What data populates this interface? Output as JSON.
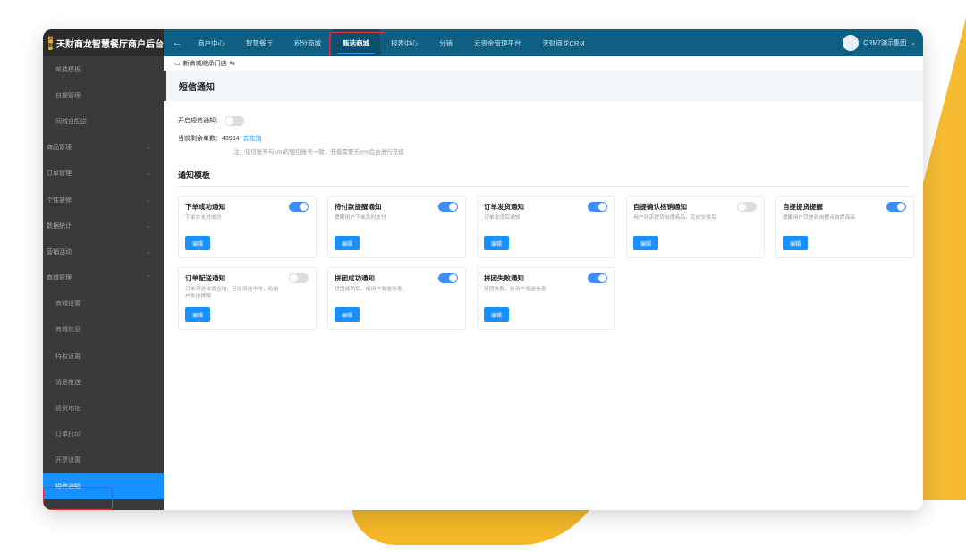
{
  "topbar": {
    "brand_logo_text": "天财商龙",
    "brand_title": "天财商龙智慧餐厅商户后台",
    "nav": [
      "商户中心",
      "智慧餐厅",
      "积分商城",
      "甄选商城",
      "报表中心",
      "分销",
      "云资金管理平台",
      "天财商龙CRM"
    ],
    "active_nav_index": 3,
    "org_name": "CRM7演示集团"
  },
  "sidebar": {
    "items": [
      {
        "label": "邮费模板",
        "type": "sub"
      },
      {
        "label": "自提管理",
        "type": "sub"
      },
      {
        "label": "同城自配送",
        "type": "sub"
      },
      {
        "label": "商品管理",
        "type": "group",
        "expanded": false
      },
      {
        "label": "订单管理",
        "type": "group",
        "expanded": false
      },
      {
        "label": "个性装修",
        "type": "group",
        "expanded": false
      },
      {
        "label": "数据统计",
        "type": "group",
        "expanded": false
      },
      {
        "label": "营销活动",
        "type": "group",
        "expanded": false
      },
      {
        "label": "商城管理",
        "type": "group",
        "expanded": true
      },
      {
        "label": "商城设置",
        "type": "sub"
      },
      {
        "label": "商城信息",
        "type": "sub"
      },
      {
        "label": "特权设置",
        "type": "sub"
      },
      {
        "label": "消息推送",
        "type": "sub"
      },
      {
        "label": "退货地址",
        "type": "sub"
      },
      {
        "label": "订单打印",
        "type": "sub"
      },
      {
        "label": "开票设置",
        "type": "sub"
      },
      {
        "label": "短信通知",
        "type": "sub",
        "active": true
      }
    ]
  },
  "breadcrumb": {
    "store": "新商城继承门店",
    "switch_icon": "⇆"
  },
  "page_title": "短信通知",
  "sms": {
    "enable_label": "开启短信通知：",
    "enabled": false,
    "balance_label": "当前剩余单数：",
    "balance": "43934",
    "recharge_label": "去充值",
    "note": "注：短信账号与crm的短信账号一致，充值需要去crm后台进行充值"
  },
  "templates_title": "通知模板",
  "edit_label": "编辑",
  "templates": [
    {
      "title": "下单成功通知",
      "desc": "下单并支付成功",
      "enabled": true
    },
    {
      "title": "待付款提醒通知",
      "desc": "提醒用户下单及时支付",
      "enabled": true
    },
    {
      "title": "订单发货通知",
      "desc": "订单发货后通知",
      "enabled": true
    },
    {
      "title": "自提确认核销通知",
      "desc": "用户到店提货自提商品，完成交易后",
      "enabled": false
    },
    {
      "title": "自提提货提醒",
      "desc": "提醒用户尽快到自提点自提商品",
      "enabled": true
    },
    {
      "title": "订单配送通知",
      "desc": "订单到达收货当地，已在派送中时，给用户发送提醒",
      "enabled": false
    },
    {
      "title": "拼团成功通知",
      "desc": "拼团成功后，给用户发送信息",
      "enabled": true
    },
    {
      "title": "拼团失败通知",
      "desc": "拼团失败，给用户发送信息",
      "enabled": true
    }
  ],
  "colors": {
    "topbar": "#0d5f83",
    "sidebar": "#3a3a3a",
    "accent": "#1890ff",
    "highlight": "#e0333a",
    "decor": "#f5b728"
  }
}
